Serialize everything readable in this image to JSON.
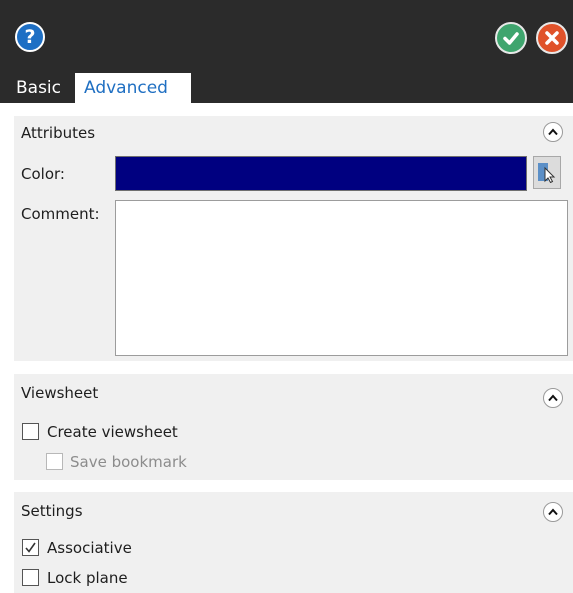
{
  "header": {
    "help_icon": "question-mark-icon",
    "ok_icon": "check-icon",
    "cancel_icon": "close-icon",
    "colors": {
      "background": "#2b2b2b",
      "ok": "#3fa56e",
      "cancel": "#e0522a",
      "help": "#1e6fc4"
    }
  },
  "tabs": [
    {
      "label": "Basic",
      "active": false
    },
    {
      "label": "Advanced",
      "active": true
    }
  ],
  "attributes": {
    "title": "Attributes",
    "color_label": "Color:",
    "color_value": "#000080",
    "comment_label": "Comment:",
    "comment_value": ""
  },
  "viewsheet": {
    "title": "Viewsheet",
    "create_viewsheet": {
      "label": "Create viewsheet",
      "checked": false
    },
    "save_bookmark": {
      "label": "Save bookmark",
      "checked": false,
      "enabled": false
    }
  },
  "settings": {
    "title": "Settings",
    "associative": {
      "label": "Associative",
      "checked": true
    },
    "lock_plane": {
      "label": "Lock plane",
      "checked": false
    }
  }
}
